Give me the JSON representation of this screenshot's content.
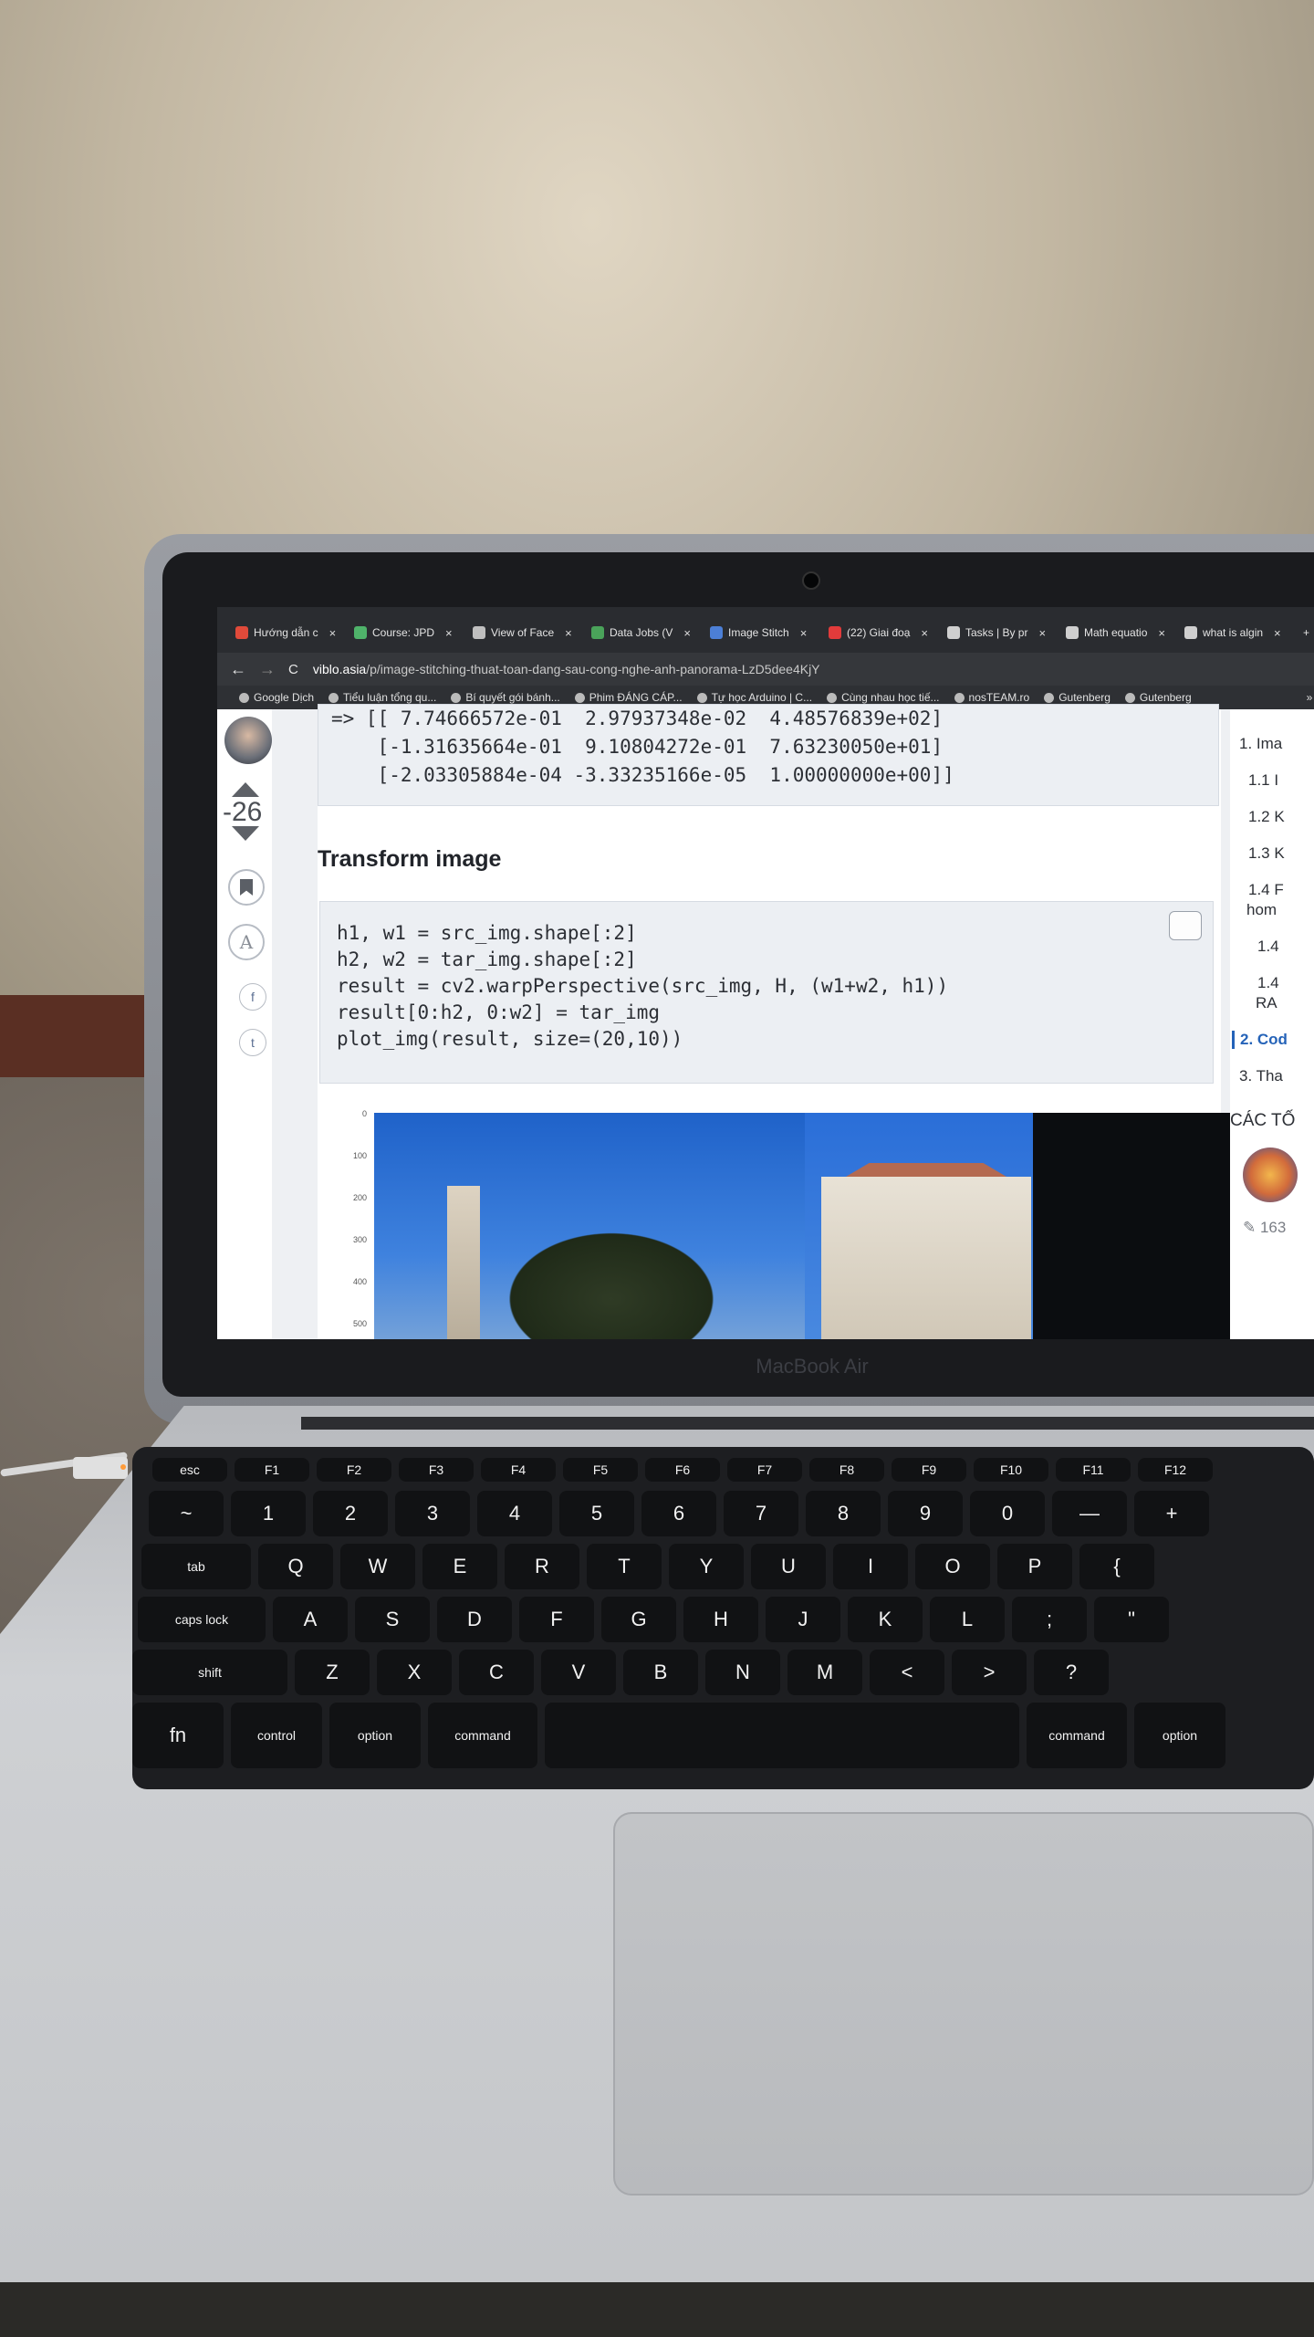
{
  "browser": {
    "tabs": [
      {
        "label": "Hướng dẫn c",
        "color": "#e04a3a"
      },
      {
        "label": "Course: JPD",
        "color": "#4fb36a"
      },
      {
        "label": "View of Face",
        "color": "#bfbfbf"
      },
      {
        "label": "Data Jobs (V",
        "color": "#4aa35a"
      },
      {
        "label": "Image Stitch",
        "color": "#4c7fd6"
      },
      {
        "label": "(22) Giai đoạ",
        "color": "#e23b3b"
      },
      {
        "label": "Tasks | By pr",
        "color": "#cfcfcf"
      },
      {
        "label": "Math equatio",
        "color": "#cfcfcf"
      },
      {
        "label": "what is algin",
        "color": "#cfcfcf"
      }
    ],
    "tab_close": "×",
    "new_tab": "+",
    "back": "←",
    "forward": "→",
    "reload": "C",
    "url_host": "viblo.asia",
    "url_path": "/p/image-stitching-thuat-toan-dang-sau-cong-nghe-anh-panorama-LzD5dee4KjY",
    "bookmarks": [
      "Google Dịch",
      "Tiểu luận tổng qu...",
      "Bí quyết gói bánh...",
      "Phim ĐÁNG CÁP...",
      "Tự học Arduino | C...",
      "Cùng nhau học tiế...",
      "nosTEAM.ro",
      "Gutenberg",
      "Gutenberg"
    ],
    "bookmarks_more": "» Oth"
  },
  "sidebar": {
    "score": "-26",
    "font_button": "A",
    "facebook": "f",
    "twitter": "t"
  },
  "article": {
    "output_lines": [
      "=> [[ 7.74666572e-01  2.97937348e-02  4.48576839e+02]",
      "    [-1.31635664e-01  9.10804272e-01  7.63230050e+01]",
      "    [-2.03305884e-04 -3.33235166e-05  1.00000000e+00]]"
    ],
    "section_title": "Transform image",
    "code_lines": [
      "h1, w1 = src_img.shape[:2]",
      "h2, w2 = tar_img.shape[:2]",
      "result = cv2.warpPerspective(src_img, H, (w1+w2, h1))",
      "result[0:h2, 0:w2] = tar_img",
      "plot_img(result, size=(20,10))"
    ],
    "plot_yticks": [
      "0",
      "100",
      "200",
      "300",
      "400",
      "500"
    ]
  },
  "toc": {
    "items": [
      "1. Ima",
      "1.1 I",
      "1.2 K",
      "1.3 K",
      "1.4 F",
      "hom",
      "1.4",
      "1.4",
      "RA",
      "2. Cod",
      "3. Tha"
    ],
    "section_label": "CÁC TỐ",
    "count": "163"
  },
  "laptop": {
    "brand": "MacBook Air"
  },
  "keyboard": {
    "fn_row": [
      "esc",
      "F1",
      "F2",
      "F3",
      "F4",
      "F5",
      "F6",
      "F7",
      "F8",
      "F9",
      "F10",
      "F11",
      "F12"
    ],
    "number_row": [
      "~",
      "1",
      "2",
      "3",
      "4",
      "5",
      "6",
      "7",
      "8",
      "9",
      "0",
      "—",
      "+"
    ],
    "q_row": [
      "tab",
      "Q",
      "W",
      "E",
      "R",
      "T",
      "Y",
      "U",
      "I",
      "O",
      "P",
      "{"
    ],
    "a_row": [
      "caps lock",
      "A",
      "S",
      "D",
      "F",
      "G",
      "H",
      "J",
      "K",
      "L",
      ";",
      "\""
    ],
    "z_row": [
      "shift",
      "Z",
      "X",
      "C",
      "V",
      "B",
      "N",
      "M",
      "<",
      ">",
      "?"
    ],
    "bottom_row": [
      "fn",
      "control",
      "option",
      "command",
      "",
      "command",
      "option"
    ]
  }
}
